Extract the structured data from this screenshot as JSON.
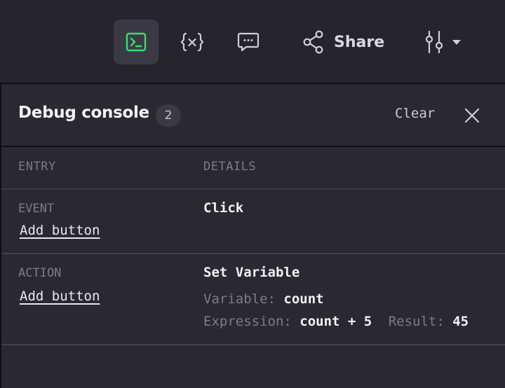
{
  "toolbar": {
    "icons": {
      "console": "terminal-icon",
      "variables": "variables-icon",
      "comments": "comment-icon",
      "share": "share-icon",
      "settings": "sliders-icon",
      "dropdown": "caret-down-icon"
    },
    "share_label": "Share",
    "console_active_color": "#3ddc6e",
    "icon_color": "#cfcfd6"
  },
  "panel": {
    "title": "Debug console",
    "count": "2",
    "clear_label": "Clear",
    "close_icon": "close-icon"
  },
  "columns": {
    "entry": "ENTRY",
    "details": "DETAILS"
  },
  "entries": [
    {
      "kind": "EVENT",
      "source": "Add button",
      "title": "Click"
    },
    {
      "kind": "ACTION",
      "source": "Add button",
      "title": "Set Variable",
      "variable_label": "Variable:",
      "variable_value": "count",
      "expression_label": "Expression:",
      "expression_value": "count + 5",
      "result_label": "Result:",
      "result_value": "45"
    }
  ]
}
